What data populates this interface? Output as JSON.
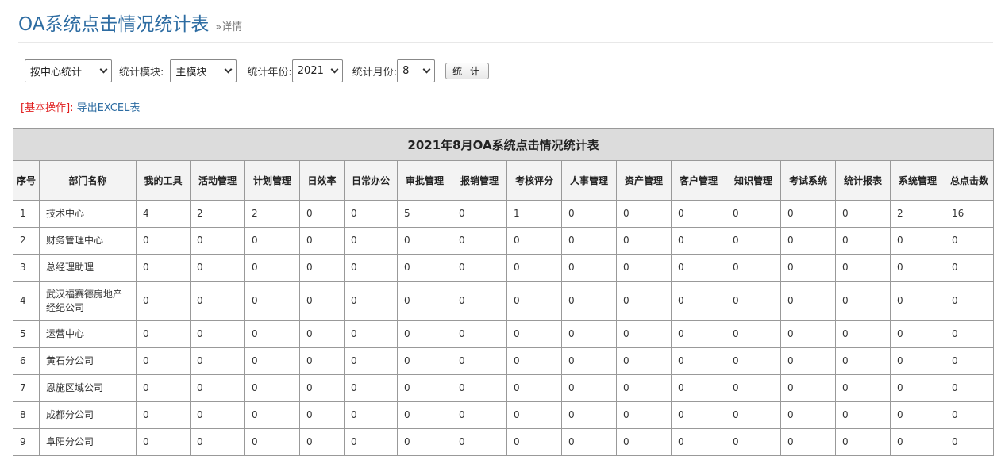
{
  "header": {
    "title": "OA系统点击情况统计表",
    "subtitle": "»详情"
  },
  "filters": {
    "group_by": "按中心统计",
    "module_label": "统计模块:",
    "module_value": "主模块",
    "year_label": "统计年份:",
    "year_value": "2021",
    "month_label": "统计月份:",
    "month_value": "8",
    "submit_label": "统 计"
  },
  "operations": {
    "label": "[基本操作]:",
    "export_link": "导出EXCEL表"
  },
  "table": {
    "caption": "2021年8月OA系统点击情况统计表",
    "columns": [
      "序号",
      "部门名称",
      "我的工具",
      "活动管理",
      "计划管理",
      "日效率",
      "日常办公",
      "审批管理",
      "报销管理",
      "考核评分",
      "人事管理",
      "资产管理",
      "客户管理",
      "知识管理",
      "考试系统",
      "统计报表",
      "系统管理",
      "总点击数"
    ],
    "rows": [
      {
        "cells": [
          "1",
          "技术中心",
          "4",
          "2",
          "2",
          "0",
          "0",
          "5",
          "0",
          "1",
          "0",
          "0",
          "0",
          "0",
          "0",
          "0",
          "2",
          "16"
        ]
      },
      {
        "cells": [
          "2",
          "财务管理中心",
          "0",
          "0",
          "0",
          "0",
          "0",
          "0",
          "0",
          "0",
          "0",
          "0",
          "0",
          "0",
          "0",
          "0",
          "0",
          "0"
        ]
      },
      {
        "cells": [
          "3",
          "总经理助理",
          "0",
          "0",
          "0",
          "0",
          "0",
          "0",
          "0",
          "0",
          "0",
          "0",
          "0",
          "0",
          "0",
          "0",
          "0",
          "0"
        ]
      },
      {
        "cells": [
          "4",
          "武汉福赛德房地产经纪公司",
          "0",
          "0",
          "0",
          "0",
          "0",
          "0",
          "0",
          "0",
          "0",
          "0",
          "0",
          "0",
          "0",
          "0",
          "0",
          "0"
        ]
      },
      {
        "cells": [
          "5",
          "运营中心",
          "0",
          "0",
          "0",
          "0",
          "0",
          "0",
          "0",
          "0",
          "0",
          "0",
          "0",
          "0",
          "0",
          "0",
          "0",
          "0"
        ]
      },
      {
        "cells": [
          "6",
          "黄石分公司",
          "0",
          "0",
          "0",
          "0",
          "0",
          "0",
          "0",
          "0",
          "0",
          "0",
          "0",
          "0",
          "0",
          "0",
          "0",
          "0"
        ]
      },
      {
        "cells": [
          "7",
          "恩施区域公司",
          "0",
          "0",
          "0",
          "0",
          "0",
          "0",
          "0",
          "0",
          "0",
          "0",
          "0",
          "0",
          "0",
          "0",
          "0",
          "0"
        ]
      },
      {
        "cells": [
          "8",
          "成都分公司",
          "0",
          "0",
          "0",
          "0",
          "0",
          "0",
          "0",
          "0",
          "0",
          "0",
          "0",
          "0",
          "0",
          "0",
          "0",
          "0"
        ]
      },
      {
        "cells": [
          "9",
          "阜阳分公司",
          "0",
          "0",
          "0",
          "0",
          "0",
          "0",
          "0",
          "0",
          "0",
          "0",
          "0",
          "0",
          "0",
          "0",
          "0",
          "0"
        ]
      }
    ]
  },
  "colors": {
    "title": "#2d6ca2",
    "accent_red": "#e02020",
    "header_bg": "#dcdcdc",
    "border": "#999999"
  }
}
